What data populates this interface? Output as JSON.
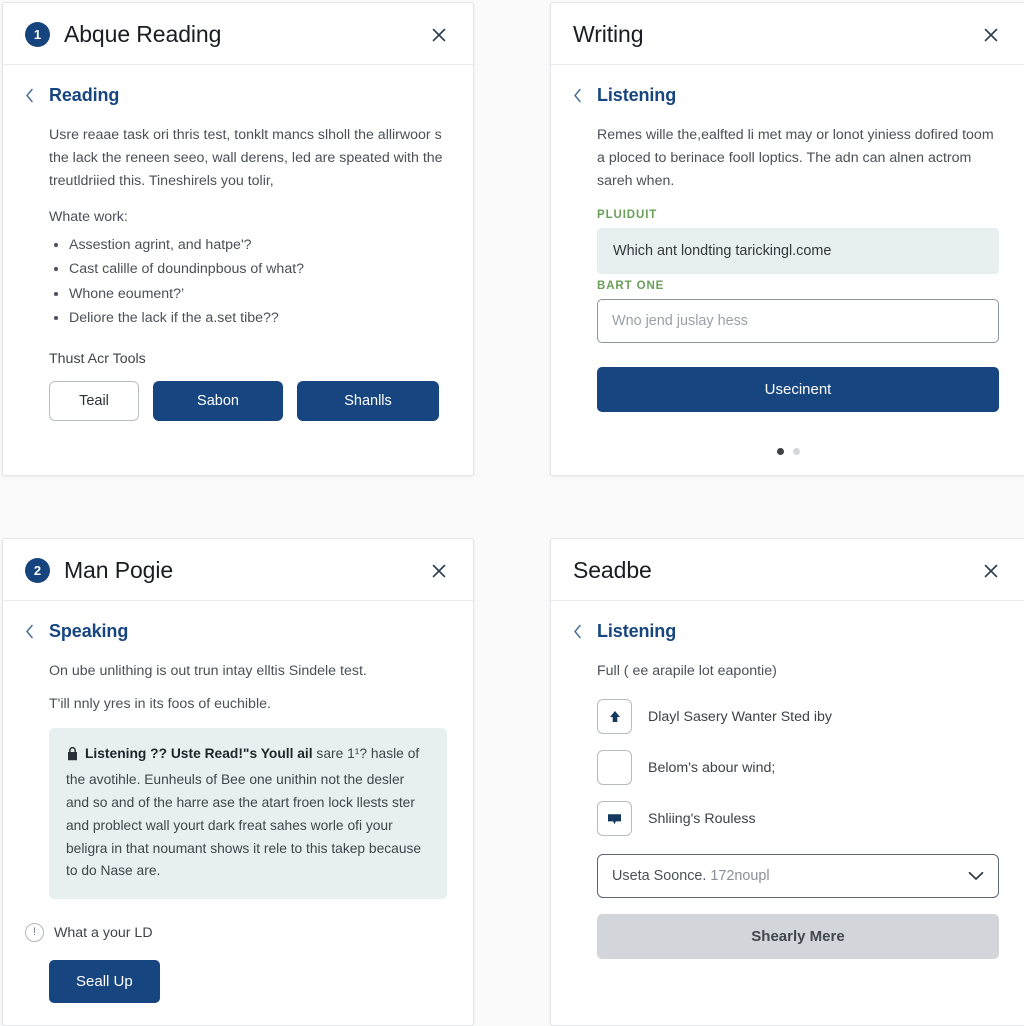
{
  "panels": {
    "reading": {
      "badge": "1",
      "title": "Abque Reading",
      "close_icon": "close-icon",
      "back_icon": "chevron-left-icon",
      "section_title": "Reading",
      "paragraph": "Usre reaae task ori thris test, tonklt mancs slholl the allirwoor s the lack the reneen seeo, wall derens, led are speated with the treutldriied this.  Tineshirels you tolir,",
      "list_label": "Whate work:",
      "list_items": [
        "Assestion agrint, and hatpe'?",
        "Cast calille of doundinpbous of what?",
        "Whone eoument?’",
        "Deliore the lack if the a.set tibe??"
      ],
      "tools_label": "Thust Acr Tools",
      "buttons": {
        "secondary": "Teail",
        "primary": "Sabon",
        "tertiary": "Shanlls"
      }
    },
    "writing": {
      "title": "Writing",
      "close_icon": "close-icon",
      "back_icon": "chevron-left-icon",
      "section_title": "Listening",
      "paragraph": "Remes wille the,ealfted li met may or lonot yiniess dofired toom a ploced to berinace fooll loptics. The adn can alnen actrom sareh when.",
      "readonly_label": "PLUIDUIT",
      "readonly_value": "Which ant londting tarickingl.come",
      "input_label": "BART ONE",
      "input_placeholder": "Wno jend juslay hess",
      "input_value": "",
      "submit_label": "Usecinent",
      "dots": [
        "active",
        "inactive"
      ]
    },
    "speaking": {
      "badge": "2",
      "title": "Man Pogie",
      "close_icon": "close-icon",
      "back_icon": "chevron-left-icon",
      "section_title": "Speaking",
      "paragraph_one": "On ube unlithing is out trun intay elltis Sindele test.",
      "paragraph_two": "T'ill nnly yres in its foos of euchible.",
      "callout_icon": "lock-icon",
      "callout_bold": "Listening ?? Uste Read!\"s Youll ail",
      "callout_text": " sare 1¹? hasle of the avotihle.  Eunheuls of Bee one unithin not the desler and so and of the harre ase the atart froen lock llests ster and problect wall yourt dark freat sahes worle ofi your beligra in that noumant shows it rele to this takep because to do Nase are.",
      "info_icon": "info-circle-icon",
      "info_text": "What a your LD",
      "button_label": "Seall Up"
    },
    "seadbe": {
      "title": "Seadbe",
      "close_icon": "close-icon",
      "back_icon": "chevron-left-icon",
      "section_title": "Listening",
      "paragraph": "Full ( ee arapile lot eapontie)",
      "options": [
        {
          "icon": "upload-icon",
          "label": "Dlayl Sasery Wanter Sted iby"
        },
        {
          "icon": "empty-square-icon",
          "label": "Belom's abour wind;"
        },
        {
          "icon": "chat-bubble-icon",
          "label": "Shliing's Rouless"
        }
      ],
      "select": {
        "icon": "chevron-down-icon",
        "value": "Useta Soonce.",
        "value_muted": "172noupl"
      },
      "footer_button": "Shearly Mere"
    }
  },
  "colors": {
    "brand_navy": "#17457f",
    "badge_navy": "#15447e",
    "green_label": "#6aa05a",
    "callout_bg": "#e8eff0",
    "disabled_btn": "#d2d6da",
    "page_bg": "#fafafa"
  }
}
